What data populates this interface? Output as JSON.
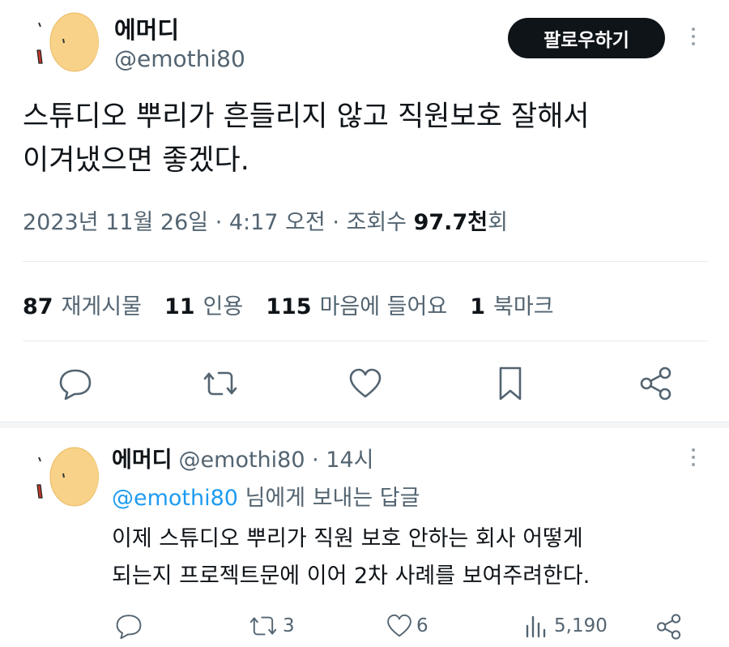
{
  "tweet": {
    "author": {
      "name": "에머디",
      "handle": "@emothi80"
    },
    "follow_label": "팔로우하기",
    "text_lines": [
      "스튜디오 뿌리가 흔들리지 않고 직원보호 잘해서",
      "이겨냈으면 좋겠다."
    ],
    "meta": {
      "date": "2023년 11월 26일 · 4:17 오전 · 조회수 ",
      "views": "97.7천",
      "views_suffix": "회"
    },
    "stats": [
      {
        "count": "87",
        "label": "재게시물"
      },
      {
        "count": "11",
        "label": "인용"
      },
      {
        "count": "115",
        "label": "마음에 들어요"
      },
      {
        "count": "1",
        "label": "북마크"
      }
    ],
    "actions": [
      "reply-icon",
      "repost-icon",
      "like-icon",
      "bookmark-icon",
      "share-icon"
    ]
  },
  "reply": {
    "author": {
      "name": "에머디",
      "handle": "@emothi80",
      "time": " · 14시"
    },
    "replying_to": {
      "mention": "@emothi80",
      "suffix": " 님에게 보내는 답글"
    },
    "text_lines": [
      "이제 스튜디오 뿌리가 직원 보호 안하는 회사 어떻게",
      "되는지 프로젝트문에 이어 2차 사례를 보여주려한다."
    ],
    "actions": {
      "replies": "",
      "reposts": "3",
      "likes": "6",
      "views": "5,190"
    }
  },
  "colors": {
    "text": "#0f1419",
    "secondary": "#536471",
    "link": "#1d9bf0",
    "avatar_fill": "#f8d288"
  }
}
